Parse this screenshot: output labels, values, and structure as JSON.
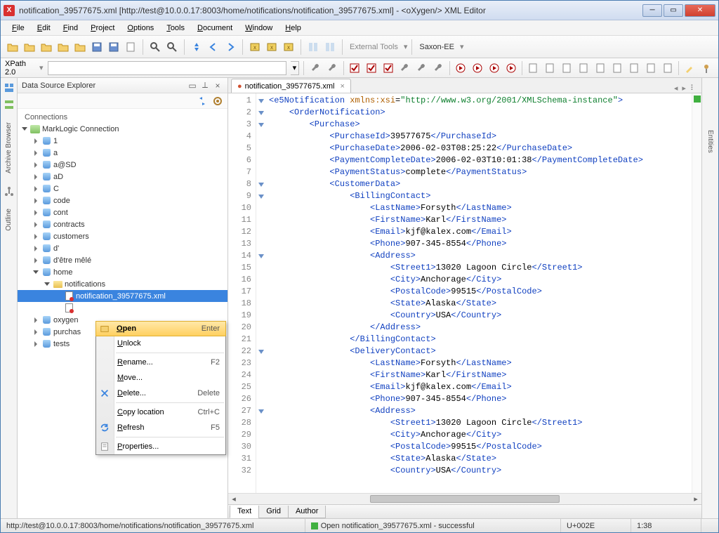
{
  "titlebar": {
    "text": "notification_39577675.xml  [http://test@10.0.0.17:8003/home/notifications/notification_39577675.xml]  -  <oXygen/> XML Editor"
  },
  "menu": [
    "File",
    "Edit",
    "Find",
    "Project",
    "Options",
    "Tools",
    "Document",
    "Window",
    "Help"
  ],
  "toolbar": {
    "external_tools": "External Tools",
    "processor": "Saxon-EE"
  },
  "toolbar2": {
    "xpath_label": "XPath 2.0"
  },
  "leftstrip": [
    "Archive Browser",
    "Outline"
  ],
  "rightstrip": [
    "Entities"
  ],
  "sidepanel": {
    "title": "Data Source Explorer",
    "connections_label": "Connections",
    "conn_name": "MarkLogic Connection",
    "dbs": [
      "1",
      "a",
      "a@SD",
      "aD",
      "C",
      "code",
      "cont",
      "contracts",
      "customers",
      "d'",
      "d'être mêlé"
    ],
    "home_label": "home",
    "notifications_label": "notifications",
    "file_selected": "notification_39577675.xml",
    "after_dbs": [
      "oxygen",
      "purchas",
      "tests"
    ]
  },
  "context_menu": {
    "items": [
      {
        "label": "Open",
        "shortcut": "Enter",
        "hl": true,
        "icon": "open"
      },
      {
        "label": "Unlock",
        "shortcut": ""
      },
      {
        "sep": true
      },
      {
        "label": "Rename...",
        "shortcut": "F2"
      },
      {
        "label": "Move...",
        "shortcut": ""
      },
      {
        "label": "Delete...",
        "shortcut": "Delete",
        "icon": "delete"
      },
      {
        "sep": true
      },
      {
        "label": "Copy location",
        "shortcut": "Ctrl+C"
      },
      {
        "label": "Refresh",
        "shortcut": "F5",
        "icon": "refresh"
      },
      {
        "sep": true
      },
      {
        "label": "Properties...",
        "shortcut": "",
        "icon": "props"
      }
    ]
  },
  "editor": {
    "tab_name": "notification_39577675.xml",
    "bottom_tabs": [
      "Text",
      "Grid",
      "Author"
    ],
    "code_lines": [
      {
        "n": 1,
        "fold": "tri",
        "html": "<span class='t'>&lt;e5Notification</span> <span class='a'>xmlns:xsi</span>=<span class='v'>\"http://www.w3.org/2001/XMLSchema-instance\"</span><span class='t'>&gt;</span>"
      },
      {
        "n": 2,
        "fold": "tri",
        "html": "    <span class='t'>&lt;OrderNotification&gt;</span>"
      },
      {
        "n": 3,
        "fold": "tri",
        "html": "        <span class='t'>&lt;Purchase&gt;</span>"
      },
      {
        "n": 4,
        "html": "            <span class='t'>&lt;PurchaseId&gt;</span><span class='tx'>39577675</span><span class='t'>&lt;/PurchaseId&gt;</span>"
      },
      {
        "n": 5,
        "html": "            <span class='t'>&lt;PurchaseDate&gt;</span><span class='tx'>2006-02-03T08:25:22</span><span class='t'>&lt;/PurchaseDate&gt;</span>"
      },
      {
        "n": 6,
        "html": "            <span class='t'>&lt;PaymentCompleteDate&gt;</span><span class='tx'>2006-02-03T10:01:38</span><span class='t'>&lt;/PaymentCompleteDate&gt;</span>"
      },
      {
        "n": 7,
        "html": "            <span class='t'>&lt;PaymentStatus&gt;</span><span class='tx'>complete</span><span class='t'>&lt;/PaymentStatus&gt;</span>"
      },
      {
        "n": 8,
        "fold": "tri",
        "html": "            <span class='t'>&lt;CustomerData&gt;</span>"
      },
      {
        "n": 9,
        "fold": "tri",
        "html": "                <span class='t'>&lt;BillingContact&gt;</span>"
      },
      {
        "n": 10,
        "html": "                    <span class='t'>&lt;LastName&gt;</span><span class='tx'>Forsyth</span><span class='t'>&lt;/LastName&gt;</span>"
      },
      {
        "n": 11,
        "html": "                    <span class='t'>&lt;FirstName&gt;</span><span class='tx'>Karl</span><span class='t'>&lt;/FirstName&gt;</span>"
      },
      {
        "n": 12,
        "html": "                    <span class='t'>&lt;Email&gt;</span><span class='tx'>kjf@kalex.com</span><span class='t'>&lt;/Email&gt;</span>"
      },
      {
        "n": 13,
        "html": "                    <span class='t'>&lt;Phone&gt;</span><span class='tx'>907-345-8554</span><span class='t'>&lt;/Phone&gt;</span>"
      },
      {
        "n": 14,
        "fold": "tri",
        "html": "                    <span class='t'>&lt;Address&gt;</span>"
      },
      {
        "n": 15,
        "html": "                        <span class='t'>&lt;Street1&gt;</span><span class='tx'>13020 Lagoon Circle</span><span class='t'>&lt;/Street1&gt;</span>"
      },
      {
        "n": 16,
        "html": "                        <span class='t'>&lt;City&gt;</span><span class='tx'>Anchorage</span><span class='t'>&lt;/City&gt;</span>"
      },
      {
        "n": 17,
        "html": "                        <span class='t'>&lt;PostalCode&gt;</span><span class='tx'>99515</span><span class='t'>&lt;/PostalCode&gt;</span>"
      },
      {
        "n": 18,
        "html": "                        <span class='t'>&lt;State&gt;</span><span class='tx'>Alaska</span><span class='t'>&lt;/State&gt;</span>"
      },
      {
        "n": 19,
        "html": "                        <span class='t'>&lt;Country&gt;</span><span class='tx'>USA</span><span class='t'>&lt;/Country&gt;</span>"
      },
      {
        "n": 20,
        "html": "                    <span class='t'>&lt;/Address&gt;</span>"
      },
      {
        "n": 21,
        "html": "                <span class='t'>&lt;/BillingContact&gt;</span>"
      },
      {
        "n": 22,
        "fold": "tri",
        "html": "                <span class='t'>&lt;DeliveryContact&gt;</span>"
      },
      {
        "n": 23,
        "html": "                    <span class='t'>&lt;LastName&gt;</span><span class='tx'>Forsyth</span><span class='t'>&lt;/LastName&gt;</span>"
      },
      {
        "n": 24,
        "html": "                    <span class='t'>&lt;FirstName&gt;</span><span class='tx'>Karl</span><span class='t'>&lt;/FirstName&gt;</span>"
      },
      {
        "n": 25,
        "html": "                    <span class='t'>&lt;Email&gt;</span><span class='tx'>kjf@kalex.com</span><span class='t'>&lt;/Email&gt;</span>"
      },
      {
        "n": 26,
        "html": "                    <span class='t'>&lt;Phone&gt;</span><span class='tx'>907-345-8554</span><span class='t'>&lt;/Phone&gt;</span>"
      },
      {
        "n": 27,
        "fold": "tri",
        "html": "                    <span class='t'>&lt;Address&gt;</span>"
      },
      {
        "n": 28,
        "html": "                        <span class='t'>&lt;Street1&gt;</span><span class='tx'>13020 Lagoon Circle</span><span class='t'>&lt;/Street1&gt;</span>"
      },
      {
        "n": 29,
        "html": "                        <span class='t'>&lt;City&gt;</span><span class='tx'>Anchorage</span><span class='t'>&lt;/City&gt;</span>"
      },
      {
        "n": 30,
        "html": "                        <span class='t'>&lt;PostalCode&gt;</span><span class='tx'>99515</span><span class='t'>&lt;/PostalCode&gt;</span>"
      },
      {
        "n": 31,
        "html": "                        <span class='t'>&lt;State&gt;</span><span class='tx'>Alaska</span><span class='t'>&lt;/State&gt;</span>"
      },
      {
        "n": 32,
        "html": "                        <span class='t'>&lt;Country&gt;</span><span class='tx'>USA</span><span class='t'>&lt;/Country&gt;</span>"
      }
    ]
  },
  "statusbar": {
    "path": "http://test@10.0.0.17:8003/home/notifications/notification_39577675.xml",
    "message": "Open notification_39577675.xml - successful",
    "char": "U+002E",
    "pos": "1:38"
  }
}
